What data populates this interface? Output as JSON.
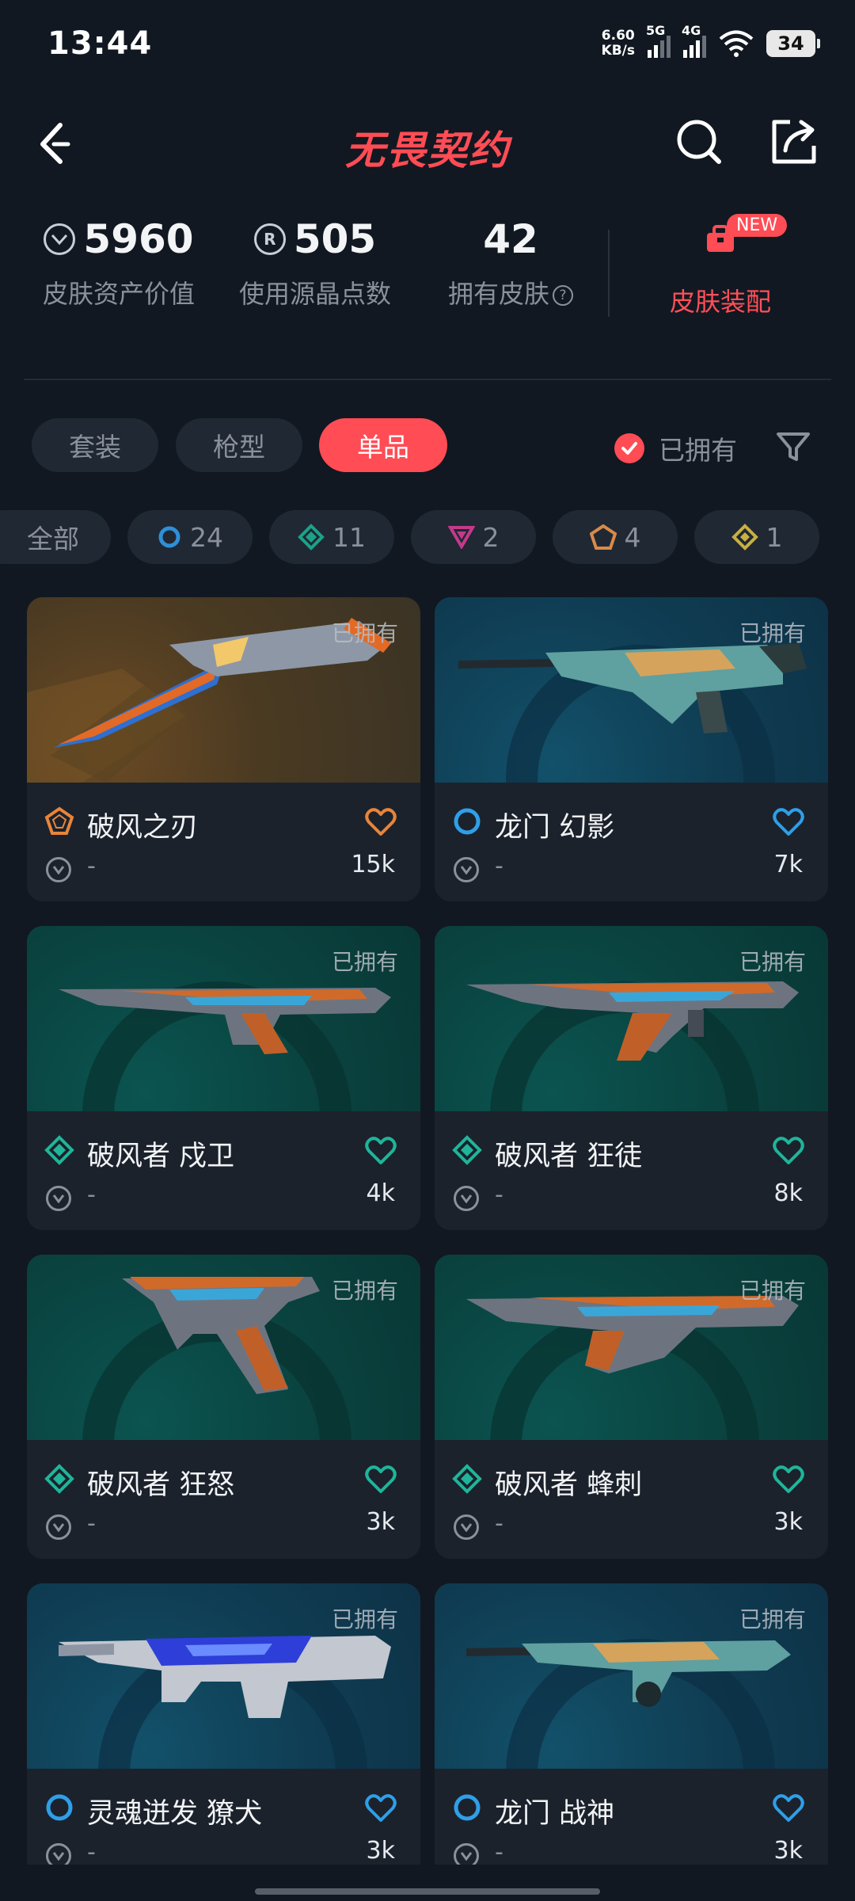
{
  "status": {
    "time": "13:44",
    "speed_value": "6.60",
    "speed_unit": "KB/s",
    "sig1": "5G",
    "sig2": "4G",
    "battery": "34"
  },
  "header": {
    "title": "无畏契约"
  },
  "stats": {
    "asset_value": "5960",
    "asset_label": "皮肤资产价值",
    "radianite_value": "505",
    "radianite_label": "使用源晶点数",
    "owned_value": "42",
    "owned_label": "拥有皮肤",
    "outfit_label": "皮肤装配",
    "new_badge": "NEW"
  },
  "filters": {
    "tabs": [
      "套装",
      "枪型",
      "单品"
    ],
    "active_tab": "单品",
    "owned_toggle": "已拥有"
  },
  "rarity_chips": [
    {
      "label": "全部",
      "icon": "all"
    },
    {
      "label": "24",
      "icon": "select-icon",
      "color": "#2f8fd8"
    },
    {
      "label": "11",
      "icon": "deluxe-icon",
      "color": "#1aa28a"
    },
    {
      "label": "2",
      "icon": "premium-icon",
      "color": "#c43a8a"
    },
    {
      "label": "4",
      "icon": "exclusive-icon",
      "color": "#d88a4a"
    },
    {
      "label": "1",
      "icon": "ultra-icon",
      "color": "#c8b040"
    }
  ],
  "cards": [
    {
      "name": "破风之刃",
      "owned": "已拥有",
      "price": "-",
      "likes": "15k",
      "rarity": "exclusive",
      "color": "#e8853a",
      "bg": "gold",
      "weapon": "knife"
    },
    {
      "name": "龙门 幻影",
      "owned": "已拥有",
      "price": "-",
      "likes": "7k",
      "rarity": "select",
      "color": "#2f9fe8",
      "bg": "blue",
      "weapon": "phantom"
    },
    {
      "name": "破风者 戍卫",
      "owned": "已拥有",
      "price": "-",
      "likes": "4k",
      "rarity": "deluxe",
      "color": "#1fb59a",
      "bg": "teal",
      "weapon": "guardian"
    },
    {
      "name": "破风者 狂徒",
      "owned": "已拥有",
      "price": "-",
      "likes": "8k",
      "rarity": "deluxe",
      "color": "#1fb59a",
      "bg": "teal",
      "weapon": "vandal"
    },
    {
      "name": "破风者 狂怒",
      "owned": "已拥有",
      "price": "-",
      "likes": "3k",
      "rarity": "deluxe",
      "color": "#1fb59a",
      "bg": "teal",
      "weapon": "frenzy"
    },
    {
      "name": "破风者 蜂刺",
      "owned": "已拥有",
      "price": "-",
      "likes": "3k",
      "rarity": "deluxe",
      "color": "#1fb59a",
      "bg": "teal",
      "weapon": "stinger"
    },
    {
      "name": "灵魂迸发 獠犬",
      "owned": "已拥有",
      "price": "-",
      "likes": "3k",
      "rarity": "select",
      "color": "#2f9fe8",
      "bg": "blue",
      "weapon": "bulldog"
    },
    {
      "name": "龙门 战神",
      "owned": "已拥有",
      "price": "-",
      "likes": "3k",
      "rarity": "select",
      "color": "#2f9fe8",
      "bg": "blue",
      "weapon": "ares"
    }
  ]
}
